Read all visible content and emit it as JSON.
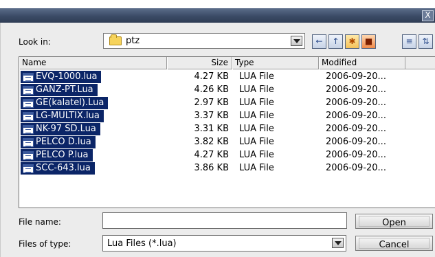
{
  "dialog": {
    "close_glyph": "X"
  },
  "look_in": {
    "label": "Look in:",
    "value": "ptz"
  },
  "toolbar": {
    "icons": [
      "back-icon",
      "up-folder-icon",
      "new-folder-icon",
      "delete-icon",
      "list-view-icon",
      "details-view-icon"
    ]
  },
  "columns": {
    "name": "Name",
    "size": "Size",
    "type": "Type",
    "modified": "Modified"
  },
  "files": [
    {
      "name": "EVQ-1000.lua",
      "size": "4.27 KB",
      "type": "LUA File",
      "modified": "2006-09-20..."
    },
    {
      "name": "GANZ-PT.Lua",
      "size": "4.26 KB",
      "type": "LUA File",
      "modified": "2006-09-20..."
    },
    {
      "name": "GE(kalatel).Lua",
      "size": "2.97 KB",
      "type": "LUA File",
      "modified": "2006-09-20..."
    },
    {
      "name": "LG-MULTIX.lua",
      "size": "3.37 KB",
      "type": "LUA File",
      "modified": "2006-09-20..."
    },
    {
      "name": "NK-97 SD.Lua",
      "size": "3.31 KB",
      "type": "LUA File",
      "modified": "2006-09-20..."
    },
    {
      "name": "PELCO D.lua",
      "size": "3.82 KB",
      "type": "LUA File",
      "modified": "2006-09-20..."
    },
    {
      "name": "PELCO P.lua",
      "size": "4.27 KB",
      "type": "LUA File",
      "modified": "2006-09-20..."
    },
    {
      "name": "SCC-643.lua",
      "size": "3.86 KB",
      "type": "LUA File",
      "modified": "2006-09-20..."
    }
  ],
  "file_name": {
    "label": "File name:",
    "value": ""
  },
  "file_type": {
    "label": "Files of type:",
    "value": "Lua Files (*.lua)"
  },
  "buttons": {
    "open": "Open",
    "cancel": "Cancel"
  },
  "colors": {
    "selection": "#0b2567",
    "titlebar": "#3b4b66"
  }
}
